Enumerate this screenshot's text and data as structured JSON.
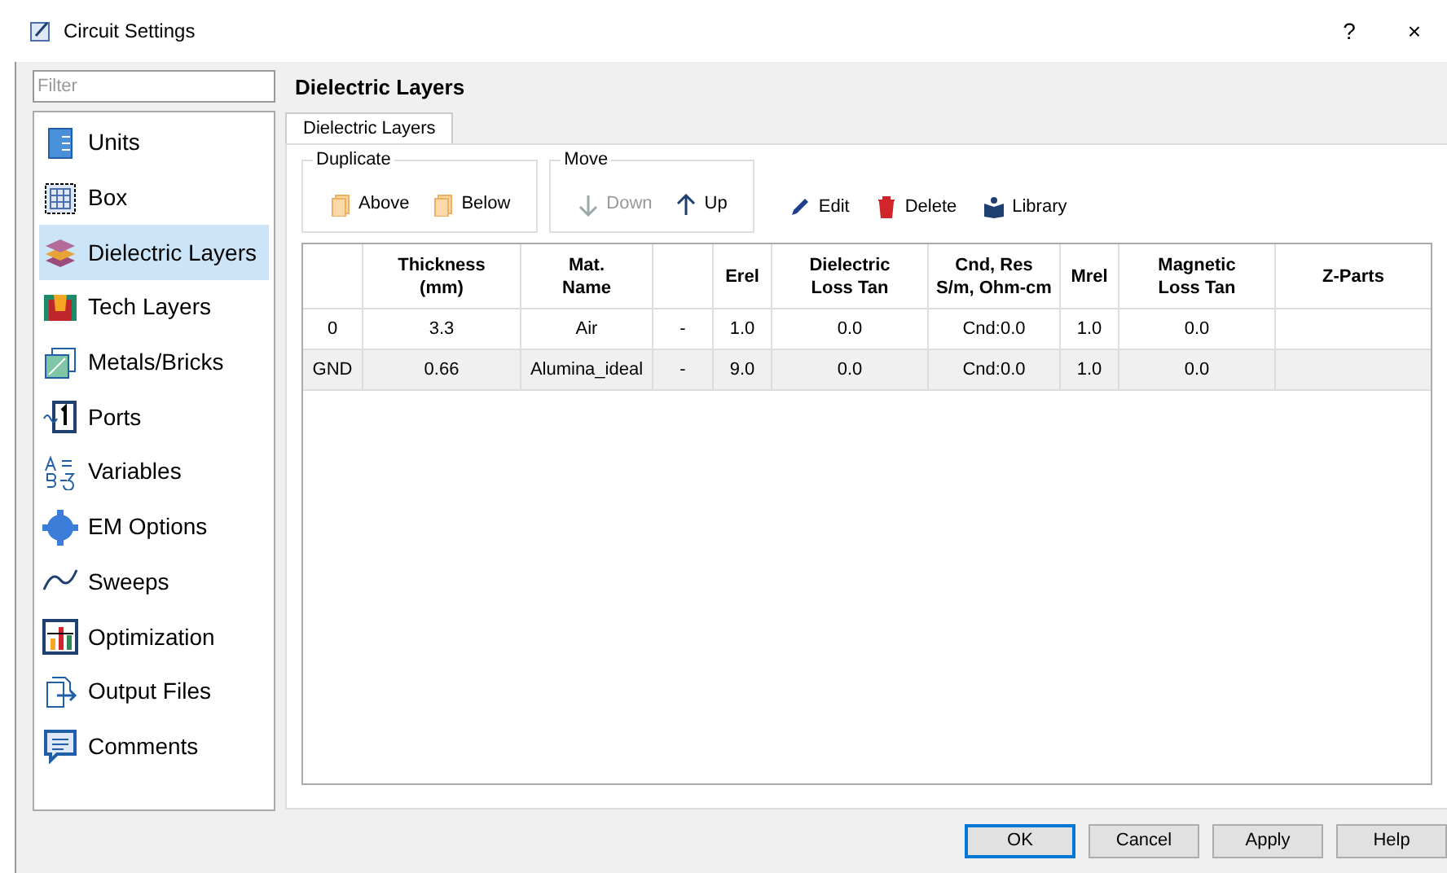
{
  "window": {
    "title": "Circuit Settings",
    "title_buttons": [
      "?",
      "×"
    ]
  },
  "sidebar": {
    "filter": {
      "placeholder": "Filter"
    },
    "items": [
      {
        "label": "Units",
        "kind": "units",
        "selected": false
      },
      {
        "label": "Box",
        "kind": "box",
        "selected": false
      },
      {
        "label": "Dielectric Layers",
        "kind": "layers",
        "selected": true
      },
      {
        "label": "Tech Layers",
        "kind": "tech",
        "selected": false
      },
      {
        "label": "Metals/Bricks",
        "kind": "metals",
        "selected": false
      },
      {
        "label": "Ports",
        "kind": "ports",
        "selected": false
      },
      {
        "label": "Variables",
        "kind": "variables",
        "selected": false
      },
      {
        "label": "EM Options",
        "kind": "em",
        "selected": false
      },
      {
        "label": "Sweeps",
        "kind": "sweeps",
        "selected": false
      },
      {
        "label": "Optimization",
        "kind": "optimization",
        "selected": false
      },
      {
        "label": "Output Files",
        "kind": "output",
        "selected": false
      },
      {
        "label": "Comments",
        "kind": "comments",
        "selected": false
      }
    ]
  },
  "page": {
    "title": "Dielectric Layers",
    "tabs": [
      {
        "label": "Dielectric Layers",
        "selected": true
      }
    ],
    "groups": [
      {
        "label": "Duplicate",
        "buttons": [
          {
            "label": "Above",
            "kind": "copy",
            "disabled": false
          },
          {
            "label": "Below",
            "kind": "copy",
            "disabled": false
          }
        ]
      },
      {
        "label": "Move",
        "buttons": [
          {
            "label": "Down",
            "kind": "down",
            "disabled": true
          },
          {
            "label": "Up",
            "kind": "up",
            "disabled": false
          }
        ]
      }
    ],
    "actions": [
      {
        "label": "Edit",
        "kind": "edit"
      },
      {
        "label": "Delete",
        "kind": "delete"
      },
      {
        "label": "Library",
        "kind": "library"
      }
    ],
    "table": {
      "columns": [
        "",
        "Thickness\n(mm)",
        "Mat.\nName",
        "",
        "Erel",
        "Dielectric\nLoss Tan",
        "Cnd, Res\nS/m, Ohm-cm",
        "Mrel",
        "Magnetic\nLoss Tan",
        "Z-Parts"
      ],
      "rows": [
        {
          "selected": false,
          "cells": [
            "0",
            "3.3",
            "Air",
            "-",
            "1.0",
            "0.0",
            "Cnd:0.0",
            "1.0",
            "0.0",
            ""
          ]
        },
        {
          "selected": true,
          "cells": [
            "GND",
            "0.66",
            "Alumina_ideal",
            "-",
            "9.0",
            "0.0",
            "Cnd:0.0",
            "1.0",
            "0.0",
            ""
          ]
        }
      ]
    }
  },
  "buttons": [
    {
      "label": "OK",
      "default": true
    },
    {
      "label": "Cancel",
      "default": false
    },
    {
      "label": "Apply",
      "default": false
    },
    {
      "label": "Help",
      "default": false
    }
  ]
}
